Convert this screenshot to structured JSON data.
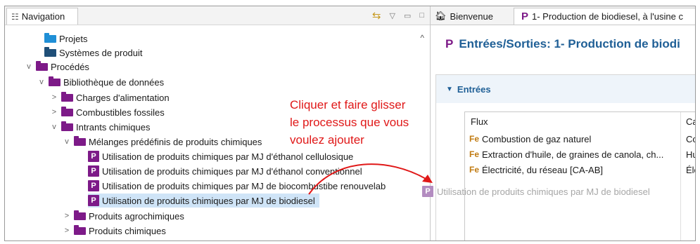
{
  "navigation": {
    "tab_label": "Navigation",
    "tree": [
      {
        "label": "Projets",
        "folder_color": "#1f8fd6"
      },
      {
        "label": "Systèmes de produit",
        "folder_color": "#1f4f78"
      },
      {
        "label": "Procédés",
        "folder_color": "#7d1a88"
      },
      {
        "label": "Bibliothèque de données",
        "folder_color": "#7d1a88"
      },
      {
        "label": "Charges d'alimentation",
        "folder_color": "#7d1a88"
      },
      {
        "label": "Combustibles fossiles",
        "folder_color": "#7d1a88"
      },
      {
        "label": "Intrants chimiques",
        "folder_color": "#7d1a88"
      },
      {
        "label": "Mélanges prédéfinis de produits chimiques",
        "folder_color": "#7d1a88"
      },
      {
        "label": "Utilisation de produits chimiques par MJ d'éthanol cellulosique",
        "badge": "P"
      },
      {
        "label": "Utilisation de produits chimiques par MJ d'éthanol conventionnel",
        "badge": "P"
      },
      {
        "label": "Utilisation de produits chimiques par MJ de biocombustibe renouvelab",
        "badge": "P"
      },
      {
        "label": "Utilisation de produits chimiques par MJ de biodiesel",
        "badge": "P",
        "selected": true
      },
      {
        "label": "Produits agrochimiques",
        "folder_color": "#7d1a88"
      },
      {
        "label": "Produits chimiques",
        "folder_color": "#7d1a88"
      }
    ]
  },
  "annotation": {
    "lines": [
      "Cliquer et faire glisser",
      "le processus que vous",
      "voulez ajouter"
    ],
    "color": "#e01818"
  },
  "drag_ghost": {
    "badge": "P",
    "label": "Utilisation de produits chimiques par MJ de biodiesel"
  },
  "editor": {
    "tabs": [
      {
        "label": "Bienvenue",
        "icon": "home-icon"
      },
      {
        "badge": "P",
        "label": "1- Production de biodiesel, à l'usine c"
      }
    ],
    "title_badge": "P",
    "title": "Entrées/Sorties: 1- Production de biodi",
    "section_label": "Entrées",
    "table": {
      "headers": [
        "Flux",
        "Cate"
      ],
      "rows": [
        {
          "flux": "Combustion de gaz naturel",
          "cat": "Con"
        },
        {
          "flux": "Extraction d'huile, de graines de canola, ch...",
          "cat": "Huil"
        },
        {
          "flux": "Électricité, du réseau [CA-AB]",
          "cat": "Élec"
        }
      ],
      "flow_icon": "Fe"
    }
  },
  "colors": {
    "accent": "#1f5f96",
    "process_purple": "#7d1a88",
    "selection": "#cfe4f7"
  }
}
